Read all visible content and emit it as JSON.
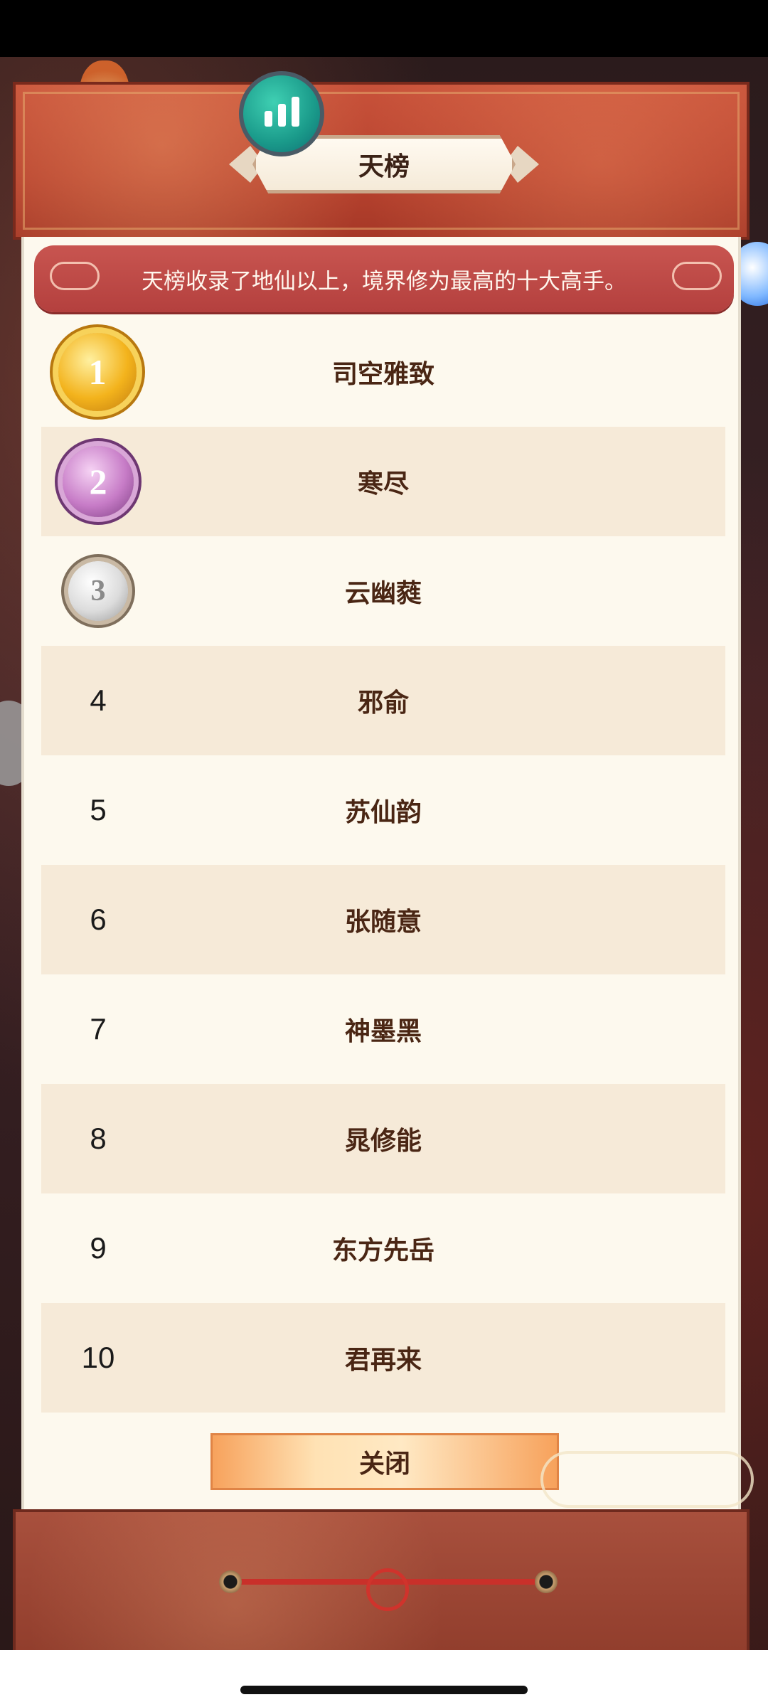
{
  "title": "天榜",
  "description": "天榜收录了地仙以上，境界修为最高的十大高手。",
  "rankings": [
    {
      "rank": "1",
      "name": "司空雅致"
    },
    {
      "rank": "2",
      "name": "寒尽"
    },
    {
      "rank": "3",
      "name": "云幽蕤"
    },
    {
      "rank": "4",
      "name": "邪俞"
    },
    {
      "rank": "5",
      "name": "苏仙韵"
    },
    {
      "rank": "6",
      "name": "张随意"
    },
    {
      "rank": "7",
      "name": "神墨黑"
    },
    {
      "rank": "8",
      "name": "晁修能"
    },
    {
      "rank": "9",
      "name": "东方先岳"
    },
    {
      "rank": "10",
      "name": "君再来"
    }
  ],
  "close_label": "关闭",
  "icons": {
    "stats": "bar-chart-icon",
    "rank_1": "gold-medal-icon",
    "rank_2": "purple-medal-icon",
    "rank_3": "silver-medal-icon"
  },
  "colors": {
    "header_red": "#b8432f",
    "panel_bg": "#fdf9ee",
    "alt_row": "#f6ead8",
    "banner_red": "#c85550",
    "name_text": "#4a2614"
  }
}
